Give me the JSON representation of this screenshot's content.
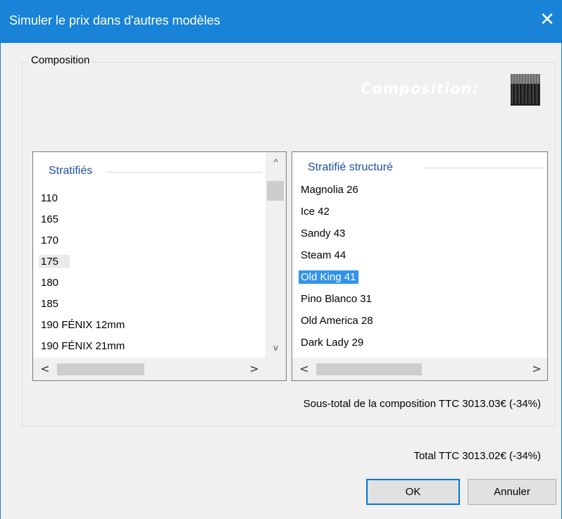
{
  "window": {
    "title": "Simuler le prix dans d'autres modèles",
    "close_glyph": "✕"
  },
  "group": {
    "label": "Composition",
    "watermark": "Composition:"
  },
  "left_list": {
    "header": "Stratifiés",
    "items": [
      "110",
      "165",
      "170",
      "175",
      "180",
      "185",
      "190 FÉNIX 12mm",
      "190 FÉNIX 21mm"
    ],
    "hovered_item": "175"
  },
  "right_list": {
    "header": "Stratifié structuré",
    "items": [
      "Magnolia 26",
      "Ice 42",
      "Sandy 43",
      "Steam 44",
      "Old King 41",
      "Pino Blanco 31",
      "Old America 28",
      "Dark Lady 29"
    ],
    "selected_item": "Old King 41"
  },
  "scroll": {
    "up": "^",
    "down": "v",
    "left": "<",
    "right": ">"
  },
  "subtotal": "Sous-total de la composition TTC 3013.03€ (-34%)",
  "total": "Total TTC 3013.02€ (-34%)",
  "buttons": {
    "ok": "OK",
    "cancel": "Annuler"
  },
  "colors": {
    "titlebar": "#1883d7",
    "selection": "#3393ea",
    "header_text": "#1f4ea8"
  }
}
